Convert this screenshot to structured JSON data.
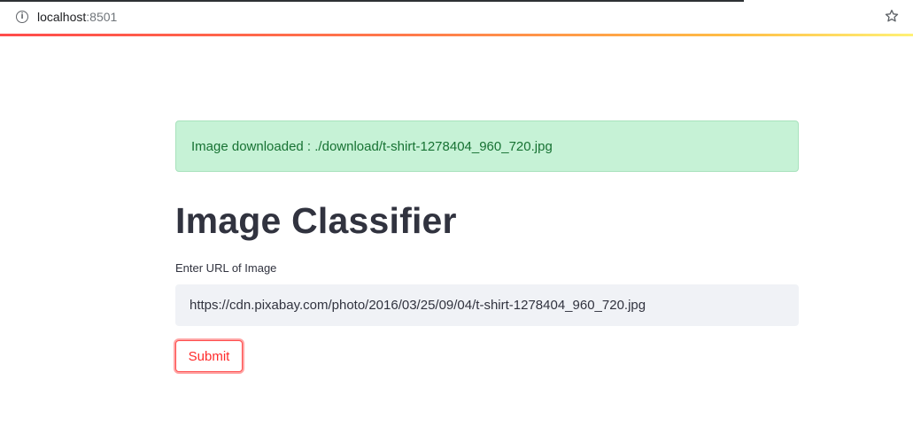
{
  "browser": {
    "url_host": "localhost",
    "url_port": ":8501",
    "info_icon": "info-icon",
    "bookmark_icon": "star-icon"
  },
  "alert": {
    "text": "Image downloaded : ./download/t-shirt-1278404_960_720.jpg",
    "status": "success",
    "background_color": "#c6f2d6",
    "text_color": "#177233"
  },
  "page": {
    "title": "Image Classifier"
  },
  "form": {
    "url_label": "Enter URL of Image",
    "url_value": "https://cdn.pixabay.com/photo/2016/03/25/09/04/t-shirt-1278404_960_720.jpg",
    "submit_label": "Submit",
    "accent_color": "#ff4b4b"
  }
}
